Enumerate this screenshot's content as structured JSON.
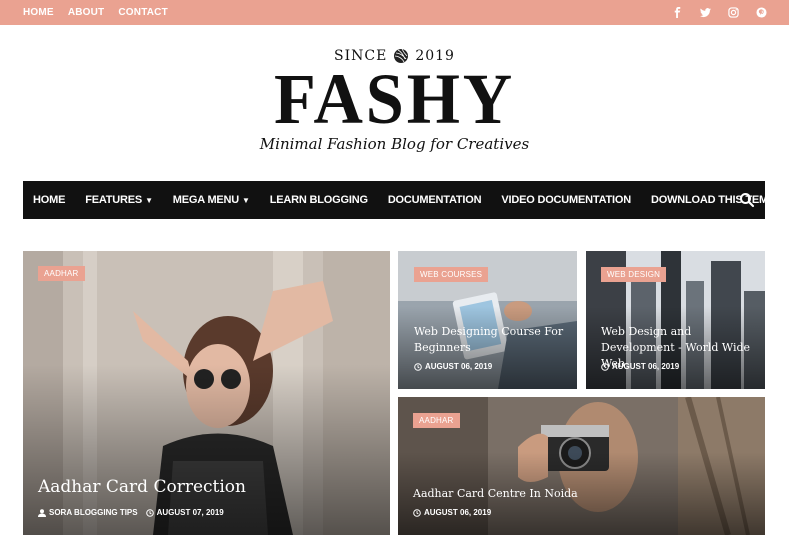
{
  "top_nav": {
    "items": [
      "HOME",
      "ABOUT",
      "CONTACT"
    ]
  },
  "social_icons": [
    "facebook-icon",
    "twitter-icon",
    "instagram-icon",
    "pinterest-icon"
  ],
  "header": {
    "since": "SINCE",
    "year": "2019",
    "brand": "FASHY",
    "tagline": "Minimal Fashion Blog for Creatives"
  },
  "main_nav": {
    "items": [
      {
        "label": "HOME",
        "dropdown": false
      },
      {
        "label": "FEATURES",
        "dropdown": true
      },
      {
        "label": "MEGA MENU",
        "dropdown": true
      },
      {
        "label": "LEARN BLOGGING",
        "dropdown": false
      },
      {
        "label": "DOCUMENTATION",
        "dropdown": false
      },
      {
        "label": "VIDEO DOCUMENTATION",
        "dropdown": false
      },
      {
        "label": "DOWNLOAD THIS TEMPLATE",
        "dropdown": false
      }
    ]
  },
  "featured": [
    {
      "category": "AADHAR",
      "title": "Aadhar Card Correction",
      "author": "SORA BLOGGING TIPS",
      "date": "AUGUST 07, 2019"
    },
    {
      "category": "WEB COURSES",
      "title": "Web Designing Course For Beginners",
      "date": "AUGUST 06, 2019"
    },
    {
      "category": "WEB DESIGN",
      "title": "Web Design and Development - World Wide Web",
      "date": "AUGUST 06, 2019"
    },
    {
      "category": "AADHAR",
      "title": "Aadhar Card Centre In Noida",
      "date": "AUGUST 06, 2019"
    }
  ],
  "colors": {
    "accent": "#eaa291",
    "nav_bg": "#111111"
  }
}
